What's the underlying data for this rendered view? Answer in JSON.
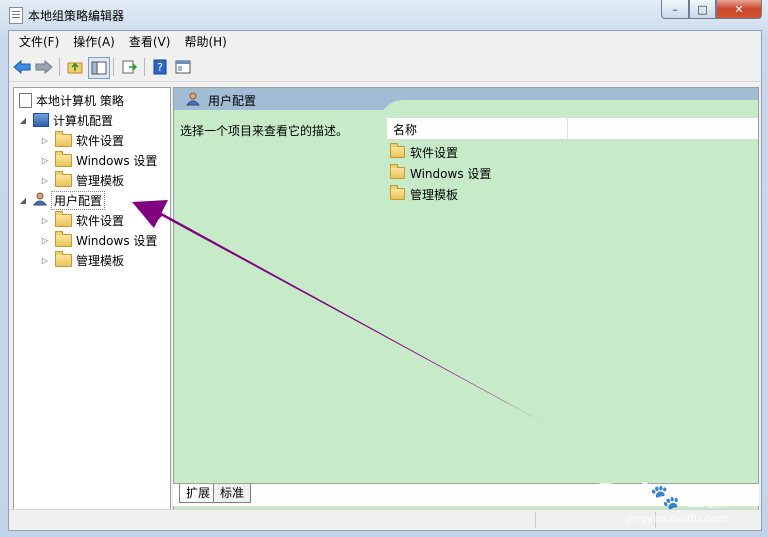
{
  "window": {
    "title": "本地组策略编辑器",
    "controls": {
      "minimize": "–",
      "maximize": "□",
      "close": "✕"
    }
  },
  "menubar": [
    {
      "label": "文件(F)"
    },
    {
      "label": "操作(A)"
    },
    {
      "label": "查看(V)"
    },
    {
      "label": "帮助(H)"
    }
  ],
  "toolbar": {
    "buttons": [
      "back-icon",
      "forward-icon",
      "up-folder-icon",
      "show-hide-tree-icon",
      "export-list-icon",
      "help-icon",
      "properties-icon"
    ]
  },
  "tree": {
    "root": "本地计算机 策略",
    "computer_config": "计算机配置",
    "user_config": "用户配置",
    "children": [
      "软件设置",
      "Windows 设置",
      "管理模板"
    ]
  },
  "right_pane": {
    "header": "用户配置",
    "description": "选择一个项目来查看它的描述。",
    "column_name": "名称",
    "items": [
      "软件设置",
      "Windows 设置",
      "管理模板"
    ]
  },
  "tabs": [
    "扩展",
    "标准"
  ],
  "watermark": {
    "brand": "Bai",
    "brand2": "经验",
    "url": "jingyan.baidu.com"
  },
  "colors": {
    "arrow": "#800080",
    "detail_bg": "#c7ebc9",
    "header_bg": "#a3bcd6"
  }
}
